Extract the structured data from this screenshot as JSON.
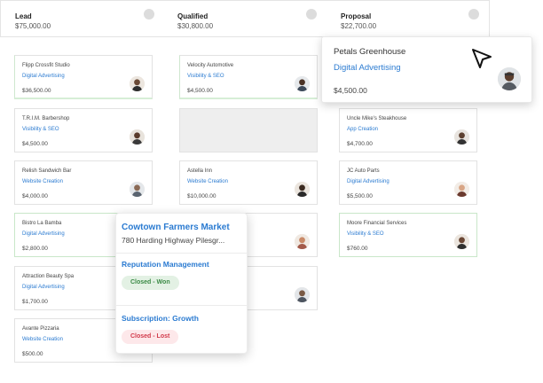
{
  "stages": [
    {
      "name": "Lead",
      "amount": "$75,000.00"
    },
    {
      "name": "Qualified",
      "amount": "$30,800.00"
    },
    {
      "name": "Proposal",
      "amount": "$22,700.00"
    }
  ],
  "lead_cards": [
    {
      "name": "Flipp Crossfit Studio",
      "service": "Digital Advertising",
      "amount": "$36,500.00"
    },
    {
      "name": "T.R.I.M. Barbershop",
      "service": "Visibility & SEO",
      "amount": "$4,500.00"
    },
    {
      "name": "Relish Sandwich Bar",
      "service": "Website Creation",
      "amount": "$4,000.00"
    },
    {
      "name": "Bistro La Bamba",
      "service": "Digital Advertising",
      "amount": "$2,800.00"
    },
    {
      "name": "Attraction Beauty Spa",
      "service": "Digital Advertising",
      "amount": "$1,700.00"
    },
    {
      "name": "Avante Pizzaria",
      "service": "Website Creation",
      "amount": "$500.00"
    }
  ],
  "qualified_cards": [
    {
      "name": "Velocity Automotive",
      "service": "Visibility & SEO",
      "amount": "$4,500.00"
    },
    {
      "name": "Astella Inn",
      "service": "Website Creation",
      "amount": "$10,000.00"
    }
  ],
  "proposal_cards": [
    {
      "name": "Uncle Mike's Steakhouse",
      "service": "App Creation",
      "amount": "$4,700.00"
    },
    {
      "name": "JC Auto Parts",
      "service": "Digital Advertising",
      "amount": "$5,500.00"
    },
    {
      "name": "Moore Financial Services",
      "service": "Visibility & SEO",
      "amount": "$760.00"
    }
  ],
  "popup": {
    "name": "Petals Greenhouse",
    "service": "Digital Advertising",
    "amount": "$4,500.00"
  },
  "overlay": {
    "title": "Cowtown Farmers Market",
    "address": "780 Harding Highway Pilesgr...",
    "section1": "Reputation Management",
    "status1": "Closed - Won",
    "section2": "Subscription: Growth",
    "status2": "Closed - Lost"
  },
  "colors": {
    "link": "#2b7bd1",
    "won": "#3a8a45",
    "lost": "#d23a4b"
  }
}
